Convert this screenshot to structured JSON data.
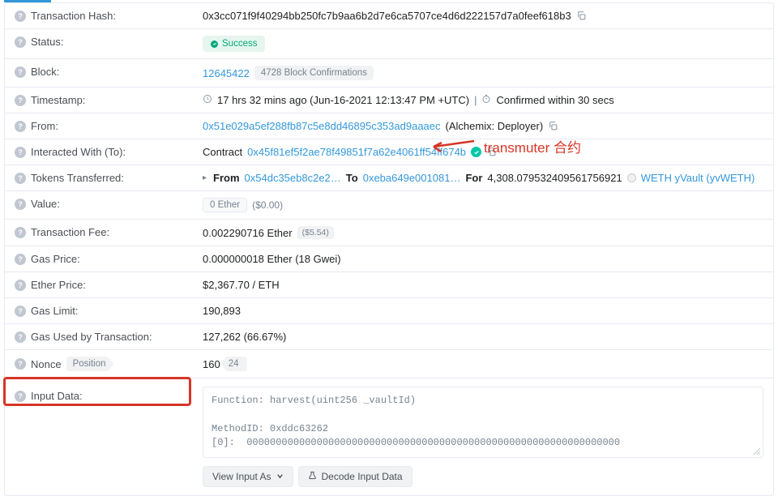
{
  "labels": {
    "txhash": "Transaction Hash:",
    "status": "Status:",
    "block": "Block:",
    "timestamp": "Timestamp:",
    "from": "From:",
    "interacted": "Interacted With (To):",
    "tokens": "Tokens Transferred:",
    "value": "Value:",
    "txfee": "Transaction Fee:",
    "gasprice": "Gas Price:",
    "etherprice": "Ether Price:",
    "gaslimit": "Gas Limit:",
    "gasused": "Gas Used by Transaction:",
    "nonce": "Nonce",
    "nonce_position": "Position",
    "inputdata": "Input Data:"
  },
  "values": {
    "txhash": "0x3cc071f9f40294bb250fc7b9aa6b2d7e6ca5707ce4d6d222157d7a0feef618b3",
    "status": "Success",
    "block_number": "12645422",
    "block_confirmations": "4728 Block Confirmations",
    "timestamp_full": "17 hrs 32 mins ago (Jun-16-2021 12:13:47 PM +UTC)",
    "timestamp_confirmed": "Confirmed within 30 secs",
    "from_address": "0x51e029a5ef288fb87c5e8dd46895c353ad9aaaec",
    "from_label": "(Alchemix: Deployer)",
    "contract_prefix": "Contract",
    "to_address": "0x45f81ef5f2ae78f49851f7a62e4061ff54ff674b",
    "token_from_label": "From",
    "token_from_addr": "0x54dc35eb8c2e2…",
    "token_to_label": "To",
    "token_to_addr": "0xeba649e001081…",
    "token_for_label": "For",
    "token_amount": "4,308.079532409561756921",
    "token_name": "WETH yVault (yvWETH)",
    "value_ether": "0 Ether",
    "value_usd": "($0.00)",
    "txfee_ether": "0.002290716 Ether",
    "txfee_usd": "($5.54)",
    "gasprice": "0.000000018 Ether (18 Gwei)",
    "etherprice": "$2,367.70 / ETH",
    "gaslimit": "190,893",
    "gasused": "127,262 (66.67%)",
    "nonce": "160",
    "nonce_pos": "24",
    "input_function": "Function: harvest(uint256 _vaultId)",
    "input_method": "MethodID: 0xddc63262",
    "input_param": "[0]:  0000000000000000000000000000000000000000000000000000000000000000"
  },
  "buttons": {
    "view_as": "View Input As",
    "decode": "Decode Input Data"
  },
  "annotation": {
    "text": "transmuter 合约"
  }
}
